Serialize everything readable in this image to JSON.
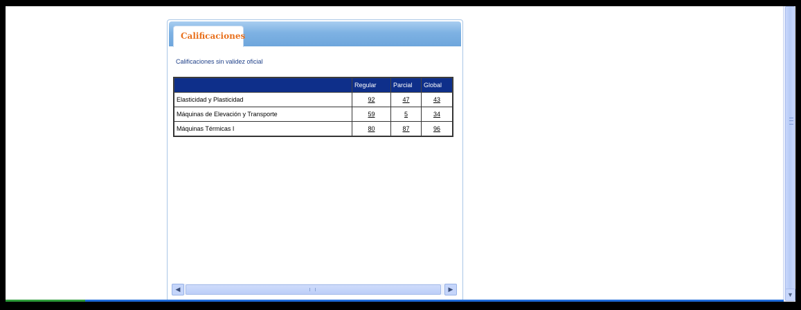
{
  "panel": {
    "tab_title": "Calificaciones",
    "subtitle": "Calificaciones sin validez oficial"
  },
  "table": {
    "headers": [
      "",
      "Regular",
      "Parcial",
      "Global"
    ],
    "rows": [
      {
        "subject": "Elasticidad y Plasticidad",
        "regular": "92",
        "parcial": "47",
        "global": "43"
      },
      {
        "subject": "Máquinas de Elevación y Transporte",
        "regular": "59",
        "parcial": "5",
        "global": "34"
      },
      {
        "subject": "Máquinas Térmicas I",
        "regular": "80",
        "parcial": "87",
        "global": "96"
      }
    ]
  },
  "icons": {
    "scroll_left": "◀",
    "scroll_right": "▶",
    "scroll_down": "▼"
  }
}
